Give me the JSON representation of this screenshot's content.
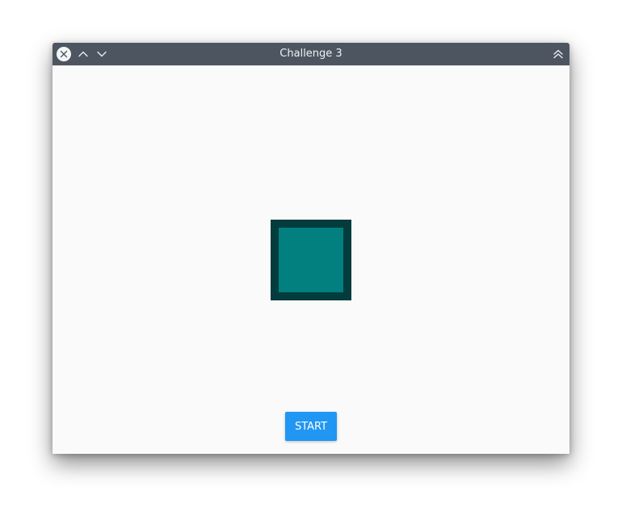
{
  "window": {
    "title": "Challenge 3"
  },
  "titlebar_buttons": {
    "close_icon": "close-icon",
    "minimize_icon": "chevron-up-icon",
    "maximize_icon": "chevron-down-icon",
    "keep_above_icon": "double-chevron-up-icon"
  },
  "main": {
    "square": {
      "fill_color": "#027f7f",
      "border_color": "#033c3c"
    },
    "start_button_label": "START",
    "start_button_color": "#2196f3"
  },
  "colors": {
    "titlebar": "#4d5660",
    "content_background": "#fafafa"
  }
}
